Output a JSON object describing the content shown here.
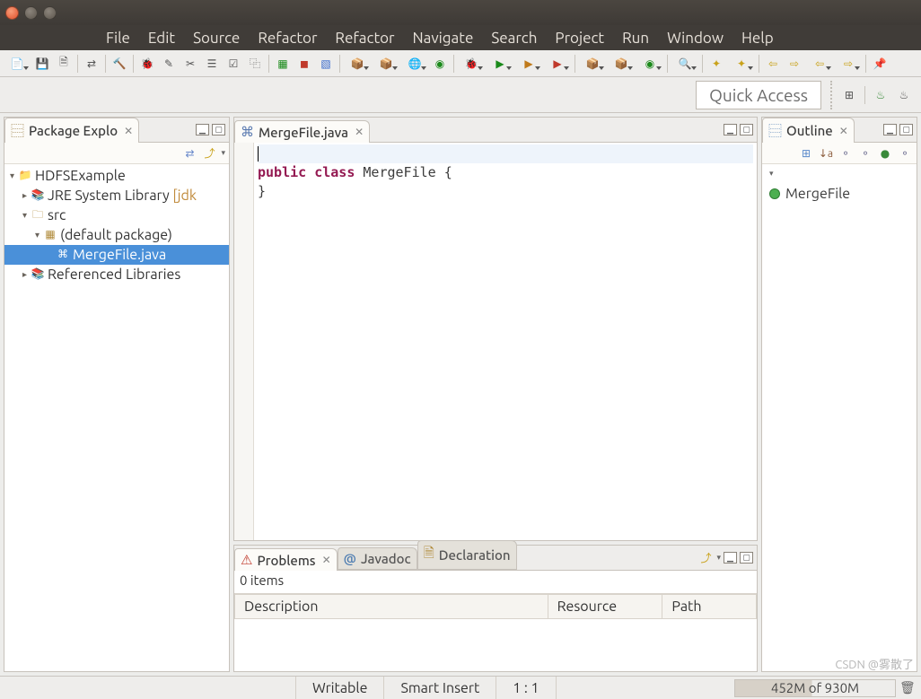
{
  "menu": {
    "items": [
      "File",
      "Edit",
      "Source",
      "Refactor",
      "Refactor",
      "Navigate",
      "Search",
      "Project",
      "Run",
      "Window",
      "Help"
    ]
  },
  "quickaccess": {
    "label": "Quick Access"
  },
  "package_explorer": {
    "title": "Package Explo",
    "tree": {
      "project": "HDFSExample",
      "jre": "JRE System Library",
      "jre_suffix": "[jdk",
      "src": "src",
      "pkg": "(default package)",
      "file": "MergeFile.java",
      "ref": "Referenced Libraries"
    }
  },
  "editor": {
    "tab": "MergeFile.java",
    "code": {
      "line1": "",
      "kw_public": "public",
      "kw_class": "class",
      "classname": " MergeFile {",
      "line3": "",
      "line4": "}"
    }
  },
  "outline": {
    "title": "Outline",
    "item": "MergeFile"
  },
  "problems": {
    "tabs": {
      "problems": "Problems",
      "javadoc": "Javadoc",
      "declaration": "Declaration"
    },
    "count": "0 items",
    "columns": {
      "c1": "Description",
      "c2": "Resource",
      "c3": "Path"
    }
  },
  "status": {
    "writable": "Writable",
    "insert": "Smart Insert",
    "pos": "1 : 1",
    "heap": "452M of 930M"
  },
  "watermark": "CSDN @雾散了"
}
